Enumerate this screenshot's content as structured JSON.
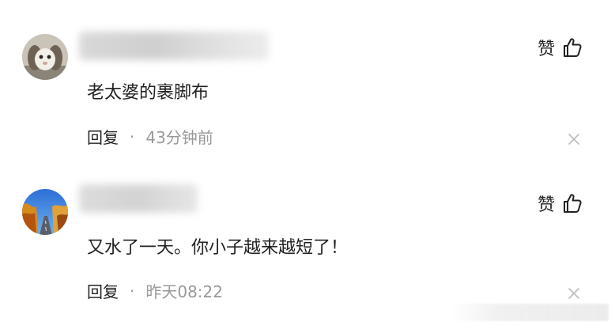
{
  "comments": [
    {
      "avatar_icon": "rabbit-avatar",
      "like_label": "赞",
      "content": "老太婆的裹脚布",
      "reply_label": "回复",
      "separator": "·",
      "time": "43分钟前"
    },
    {
      "avatar_icon": "autumn-road-avatar",
      "like_label": "赞",
      "content": "又水了一天。你小子越来越短了！",
      "reply_label": "回复",
      "separator": "·",
      "time": "昨天08:22"
    }
  ],
  "colors": {
    "text_primary": "#222222",
    "text_secondary": "#999999",
    "icon_gray": "#bbbbbb"
  }
}
